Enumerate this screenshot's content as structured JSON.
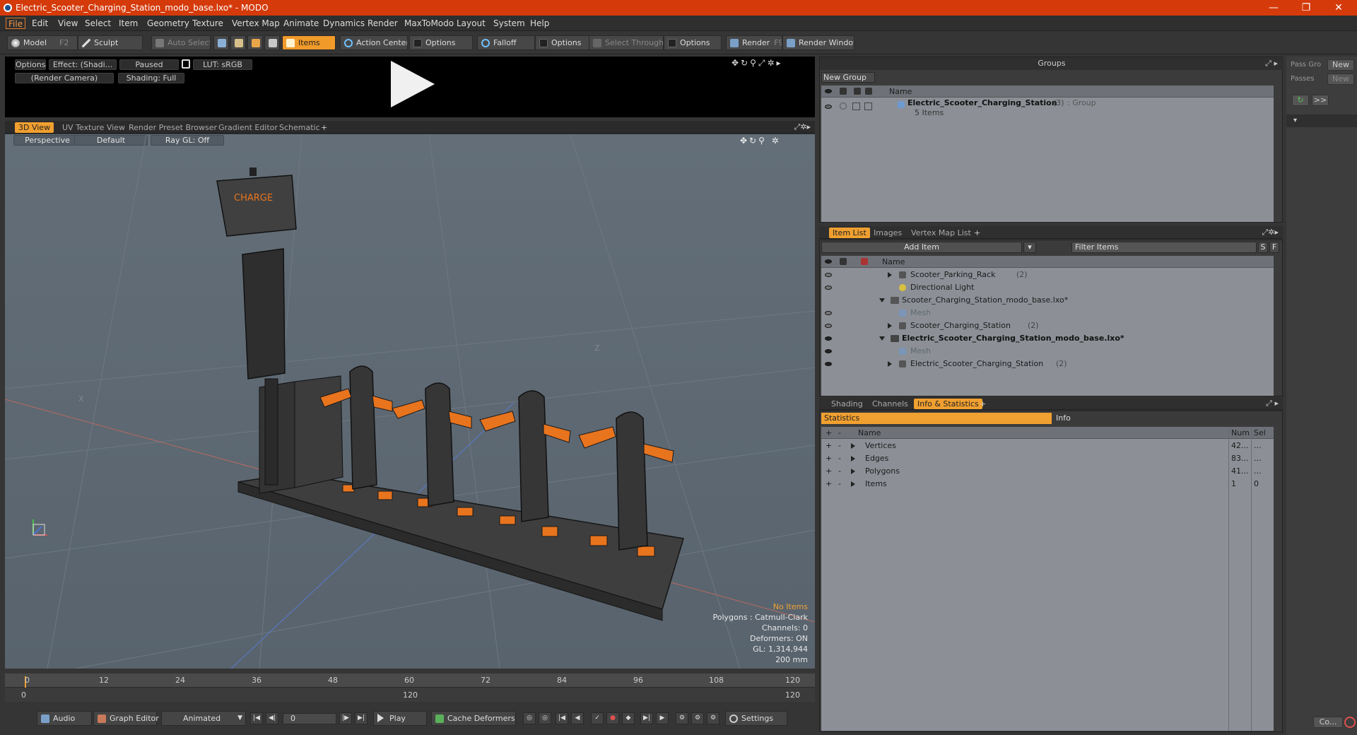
{
  "window": {
    "title": "Electric_Scooter_Charging_Station_modo_base.lxo* - MODO",
    "minimize": "—",
    "restore": "❐",
    "close": "✕"
  },
  "menu": [
    "File",
    "Edit",
    "View",
    "Select",
    "Item",
    "Geometry",
    "Texture",
    "Vertex Map",
    "Animate",
    "Dynamics",
    "Render",
    "MaxToModo",
    "Layout",
    "System",
    "Help"
  ],
  "toolbar": {
    "model": "Model",
    "model_key": "F2",
    "sculpt": "Sculpt",
    "auto_select": "Auto Select",
    "items": "Items",
    "action_center": "Action Center",
    "options1": "Options",
    "falloff": "Falloff",
    "options2": "Options",
    "select_through": "Select Through",
    "options3": "Options",
    "render": "Render",
    "render_key": "F9",
    "render_window": "Render Window"
  },
  "preview": {
    "options": "Options",
    "effect": "Effect: (Shadi...",
    "paused": "Paused",
    "lut": "LUT: sRGB",
    "camera": "(Render Camera)",
    "shading": "Shading: Full"
  },
  "view_tabs": [
    "3D View",
    "UV Texture View",
    "Render Preset Browser",
    "Gradient Editor",
    "Schematic",
    "+"
  ],
  "viewport": {
    "perspective": "Perspective",
    "default": "Default",
    "raygl": "Ray GL: Off",
    "sign_text": "CHARGE",
    "axis_x": "X",
    "axis_z": "Z",
    "info": {
      "no_items": "No Items",
      "polygons": "Polygons : Catmull-Clark",
      "channels": "Channels: 0",
      "deformers": "Deformers: ON",
      "gl": "GL: 1,314,944",
      "size": "200 mm"
    }
  },
  "timeline": {
    "ticks": [
      "0",
      "12",
      "24",
      "36",
      "48",
      "60",
      "72",
      "84",
      "96",
      "108",
      "120"
    ],
    "start": "0",
    "mid": "120",
    "end": "120"
  },
  "bottom": {
    "audio": "Audio",
    "graph_editor": "Graph Editor",
    "animated": "Animated",
    "frame": "0",
    "play": "Play",
    "cache_deformers": "Cache Deformers",
    "settings": "Settings"
  },
  "groups": {
    "title": "Groups",
    "new_group": "New Group",
    "col_name": "Name",
    "item_name": "Electric_Scooter_Charging_Station",
    "item_count": "(3)",
    "item_type": ": Group",
    "item_sub": "5 Items"
  },
  "item_list": {
    "tabs": [
      "Item List",
      "Images",
      "Vertex Map List",
      "+"
    ],
    "add_item": "Add Item",
    "filter": "Filter Items",
    "s": "S",
    "f": "F",
    "col_name": "Name",
    "rows": [
      {
        "name": "Scooter_Parking_Rack",
        "count": "(2)"
      },
      {
        "name": "Directional Light",
        "count": ""
      },
      {
        "name": "Scooter_Charging_Station_modo_base.lxo*",
        "count": ""
      },
      {
        "name": "Mesh",
        "count": ""
      },
      {
        "name": "Scooter_Charging_Station",
        "count": "(2)"
      },
      {
        "name": "Electric_Scooter_Charging_Station_modo_base.lxo*",
        "count": ""
      },
      {
        "name": "Mesh",
        "count": ""
      },
      {
        "name": "Electric_Scooter_Charging_Station",
        "count": "(2)"
      }
    ]
  },
  "stats": {
    "tabs": [
      "Shading",
      "Channels",
      "Info & Statistics",
      "+"
    ],
    "sub_statistics": "Statistics",
    "sub_info": "Info",
    "col_name": "Name",
    "col_num": "Num",
    "col_sel": "Sel",
    "rows": [
      {
        "name": "Vertices",
        "num": "42...",
        "sel": "..."
      },
      {
        "name": "Edges",
        "num": "83...",
        "sel": "..."
      },
      {
        "name": "Polygons",
        "num": "41...",
        "sel": "..."
      },
      {
        "name": "Items",
        "num": "1",
        "sel": "0"
      }
    ]
  },
  "far_right": {
    "pass_groups": "Pass Gro",
    "passes": "Passes",
    "new1": "New",
    "new2": "New",
    "more": ">>",
    "co": "Co..."
  },
  "colors": {
    "accent": "#f0a030",
    "titlebar": "#d53a0a",
    "orange_mesh": "#e8741e"
  }
}
